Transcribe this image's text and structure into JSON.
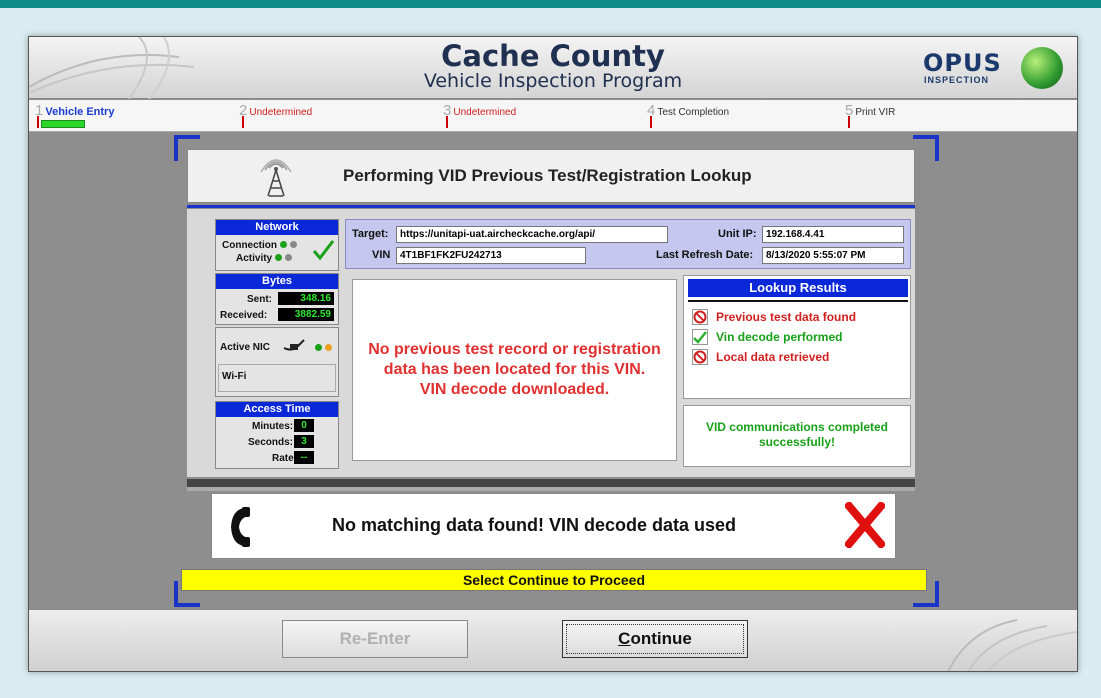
{
  "header": {
    "title": "Cache County",
    "subtitle": "Vehicle Inspection Program",
    "logo_text": "OPUS",
    "logo_sub": "INSPECTION"
  },
  "steps": [
    {
      "num": "1",
      "label": "Vehicle Entry",
      "color": "#1a3ad0"
    },
    {
      "num": "2",
      "label": "Undetermined",
      "color": "#d02020"
    },
    {
      "num": "3",
      "label": "Undetermined",
      "color": "#d02020"
    },
    {
      "num": "4",
      "label": "Test Completion",
      "color": "#333333"
    },
    {
      "num": "5",
      "label": "Print VIR",
      "color": "#333333"
    }
  ],
  "panel": {
    "title": "Performing VID Previous Test/Registration Lookup"
  },
  "network": {
    "header": "Network",
    "connection_label": "Connection",
    "activity_label": "Activity",
    "bytes_header": "Bytes",
    "sent_label": "Sent:",
    "sent_value": "348.16",
    "received_label": "Received:",
    "received_value": "3882.59",
    "active_nic_label": "Active NIC",
    "nic_name": "Wi-Fi",
    "access_header": "Access Time",
    "minutes_label": "Minutes:",
    "minutes_value": "0",
    "seconds_label": "Seconds:",
    "seconds_value": "3",
    "rate_label": "Rate:",
    "rate_value": "--"
  },
  "info": {
    "target_label": "Target:",
    "target_value": "https://unitapi-uat.aircheckcache.org/api/",
    "unit_ip_label": "Unit IP:",
    "unit_ip_value": "192.168.4.41",
    "vin_label": "VIN",
    "vin_value": "4T1BF1FK2FU242713",
    "last_refresh_label": "Last Refresh Date:",
    "last_refresh_value": "8/13/2020 5:55:07 PM"
  },
  "message": {
    "line1": "No previous test record or registration",
    "line2": "data has been located for this VIN.",
    "line3": "VIN decode downloaded."
  },
  "results": {
    "header": "Lookup Results",
    "items": [
      {
        "label": "Previous test data found",
        "icon": "prohibited-icon",
        "color": "#d02020"
      },
      {
        "label": "Vin decode performed",
        "icon": "checkmark-icon",
        "color": "#18a018"
      },
      {
        "label": "Local data retrieved",
        "icon": "prohibited-icon",
        "color": "#d02020"
      }
    ]
  },
  "status": {
    "line1": "VID communications completed",
    "line2": "successfully!"
  },
  "notice": {
    "text": "No matching data found! VIN decode data used"
  },
  "prompt": "Select Continue to Proceed",
  "buttons": {
    "reenter": "Re-Enter",
    "continue_rest": "ontinue",
    "continue_underlined": "C"
  }
}
